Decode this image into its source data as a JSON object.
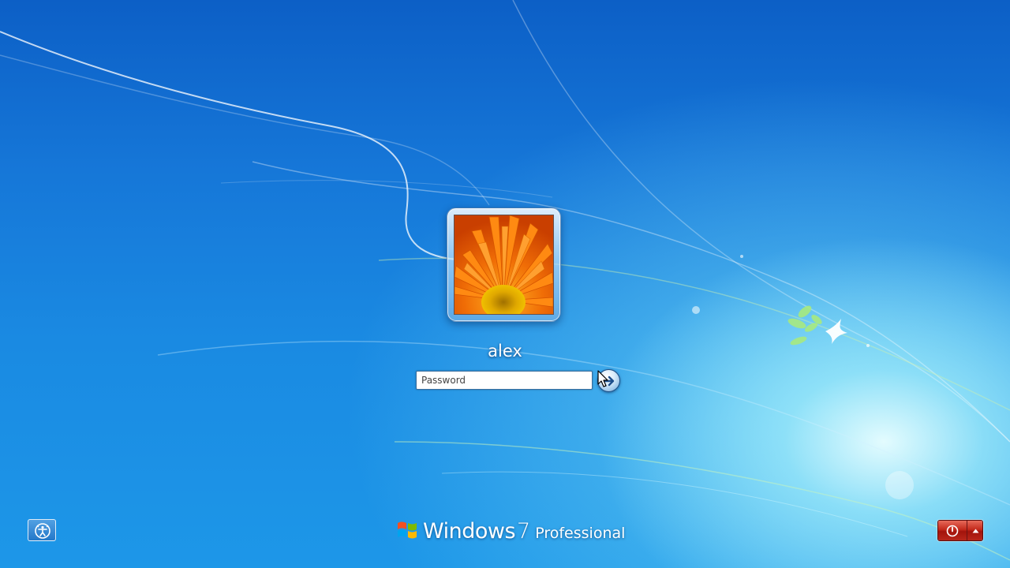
{
  "logon": {
    "username": "alex",
    "password_placeholder": "Password",
    "password_value": ""
  },
  "branding": {
    "name": "Windows",
    "version": "7",
    "edition": "Professional"
  },
  "icons": {
    "user_picture": "orange-flower-user-picture",
    "submit": "arrow-right-icon",
    "ease_of_access": "ease-of-access-icon",
    "shutdown": "power-icon",
    "shutdown_options": "triangle-up-icon",
    "windows_logo": "windows-flag-icon"
  },
  "colors": {
    "background_top": "#0c5fc6",
    "background_bottom": "#1d97e8",
    "shutdown_red": "#c42a1c"
  }
}
